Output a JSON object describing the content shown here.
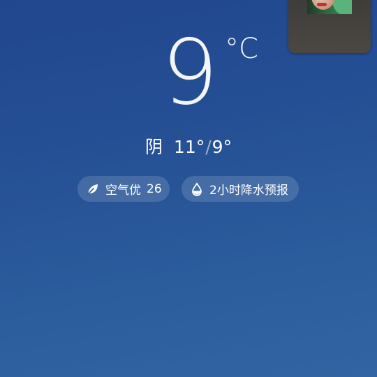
{
  "weather": {
    "temperature": "9",
    "unit": "°C",
    "condition": "阴",
    "high": "11°",
    "low": "9°",
    "separator": "/"
  },
  "pills": {
    "air_label": "空气优",
    "air_value": "26",
    "air_icon": "leaf-icon",
    "rain_label": "2小时降水预报",
    "rain_icon": "water-drop-icon"
  },
  "pip": {
    "icon": "video-thumbnail"
  }
}
